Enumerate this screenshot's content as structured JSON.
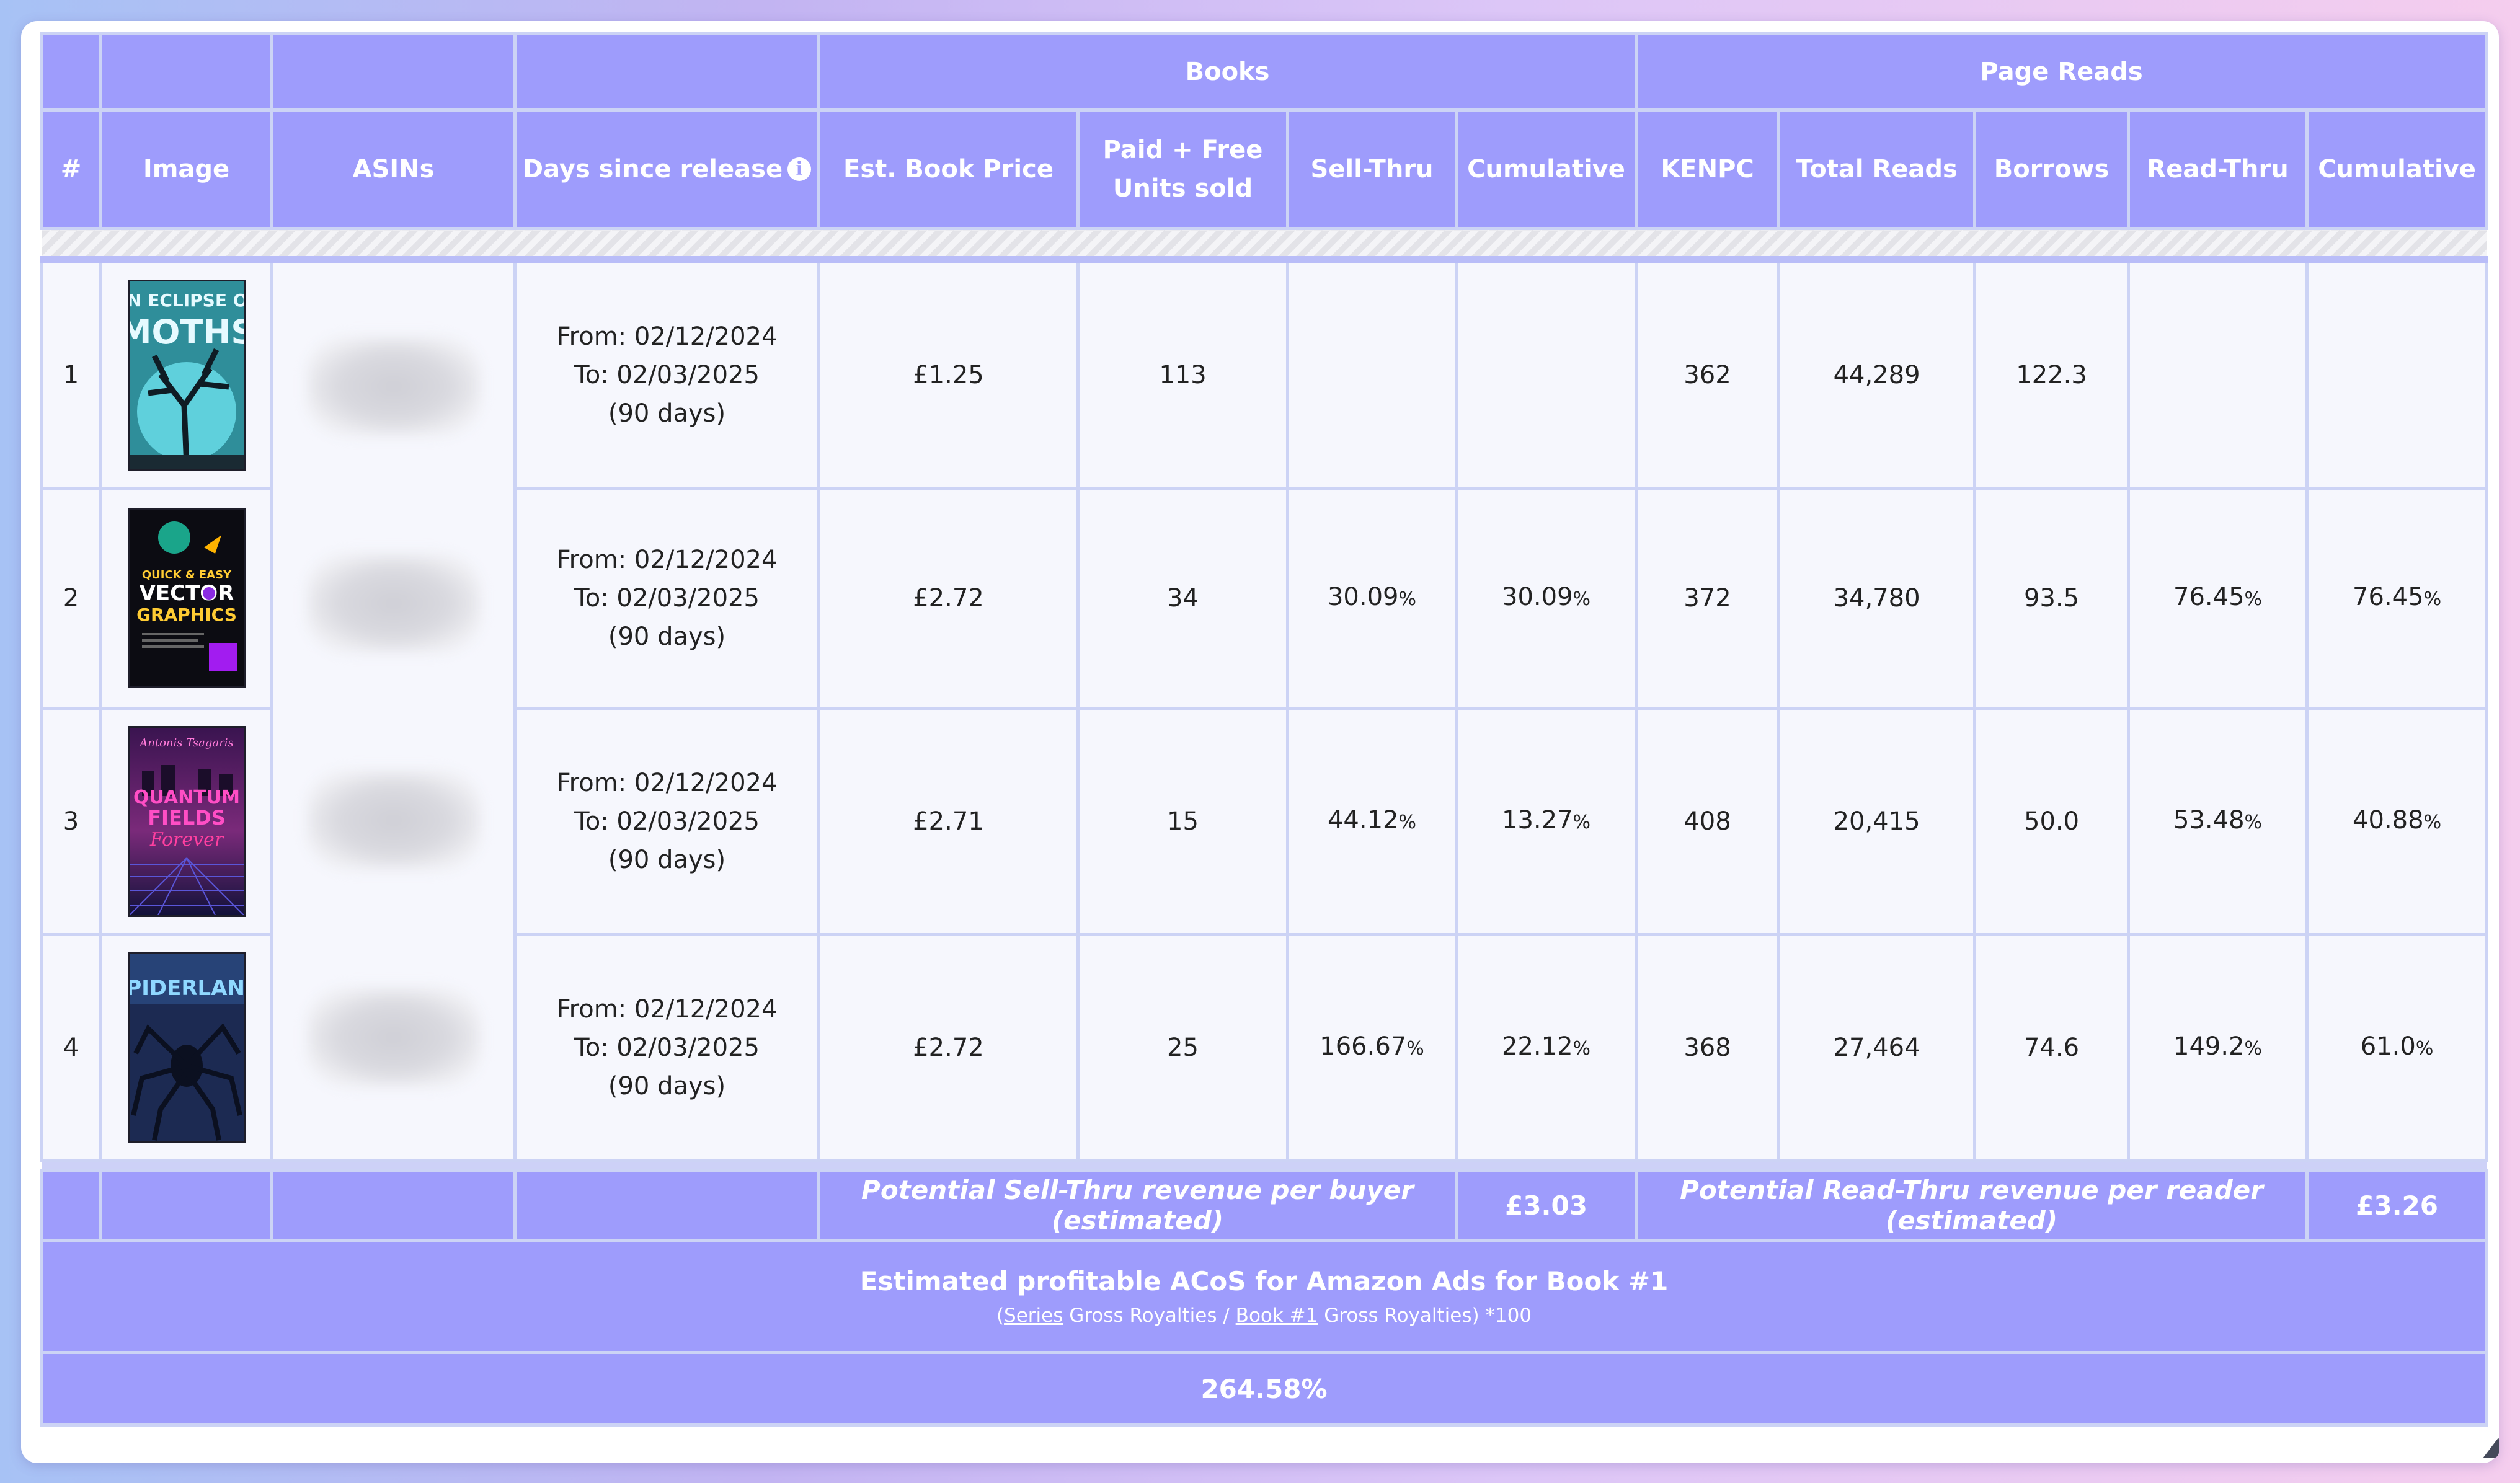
{
  "table": {
    "group_headers": {
      "books": "Books",
      "page_reads": "Page Reads"
    },
    "columns": {
      "num": "#",
      "image": "Image",
      "asins": "ASINs",
      "days": "Days since release",
      "price": "Est. Book Price",
      "units_line1": "Paid + Free",
      "units_line2": "Units sold",
      "sell_thru": "Sell-Thru",
      "books_cumulative": "Cumulative",
      "kenpc": "KENPC",
      "total_reads": "Total Reads",
      "borrows": "Borrows",
      "read_thru": "Read-Thru",
      "reads_cumulative": "Cumulative"
    },
    "rows": [
      {
        "num": "1",
        "cover_title": "AN ECLIPSE OF MOTHS",
        "from": "From: 02/12/2024",
        "to": "To: 02/03/2025",
        "days": "(90 days)",
        "price": "£1.25",
        "units": "113",
        "sell_thru": "",
        "sell_thru_pct": "",
        "books_cumulative": "",
        "books_cumulative_pct": "",
        "kenpc": "362",
        "total_reads": "44,289",
        "borrows": "122.3",
        "read_thru": "",
        "read_thru_pct": "",
        "reads_cumulative": "",
        "reads_cumulative_pct": ""
      },
      {
        "num": "2",
        "cover_title": "QUICK & EASY VECTOR GRAPHICS",
        "from": "From: 02/12/2024",
        "to": "To: 02/03/2025",
        "days": "(90 days)",
        "price": "£2.72",
        "units": "34",
        "sell_thru": "30.09",
        "sell_thru_pct": "%",
        "books_cumulative": "30.09",
        "books_cumulative_pct": "%",
        "kenpc": "372",
        "total_reads": "34,780",
        "borrows": "93.5",
        "read_thru": "76.45",
        "read_thru_pct": "%",
        "reads_cumulative": "76.45",
        "reads_cumulative_pct": "%"
      },
      {
        "num": "3",
        "cover_title": "QUANTUM FIELDS Forever",
        "from": "From: 02/12/2024",
        "to": "To: 02/03/2025",
        "days": "(90 days)",
        "price": "£2.71",
        "units": "15",
        "sell_thru": "44.12",
        "sell_thru_pct": "%",
        "books_cumulative": "13.27",
        "books_cumulative_pct": "%",
        "kenpc": "408",
        "total_reads": "20,415",
        "borrows": "50.0",
        "read_thru": "53.48",
        "read_thru_pct": "%",
        "reads_cumulative": "40.88",
        "reads_cumulative_pct": "%"
      },
      {
        "num": "4",
        "cover_title": "SPIDERLAND",
        "from": "From: 02/12/2024",
        "to": "To: 02/03/2025",
        "days": "(90 days)",
        "price": "£2.72",
        "units": "25",
        "sell_thru": "166.67",
        "sell_thru_pct": "%",
        "books_cumulative": "22.12",
        "books_cumulative_pct": "%",
        "kenpc": "368",
        "total_reads": "27,464",
        "borrows": "74.6",
        "read_thru": "149.2",
        "read_thru_pct": "%",
        "reads_cumulative": "61.0",
        "reads_cumulative_pct": "%"
      }
    ],
    "footer": {
      "sell_thru_label": "Potential Sell-Thru revenue per buyer (estimated)",
      "sell_thru_value": "£3.03",
      "read_thru_label": "Potential Read-Thru revenue per reader (estimated)",
      "read_thru_value": "£3.26",
      "acos_title": "Estimated profitable ACoS for Amazon Ads for Book #1",
      "formula_open": "(",
      "formula_series": "Series",
      "formula_mid1": " Gross Royalties / ",
      "formula_book": "Book #1",
      "formula_mid2": " Gross Royalties) *100",
      "acos_value": "264.58%"
    }
  },
  "colors": {
    "header_bg": "#9e9cfc",
    "cell_bg": "#f6f7fd",
    "grid_line": "#ccd3f5"
  }
}
